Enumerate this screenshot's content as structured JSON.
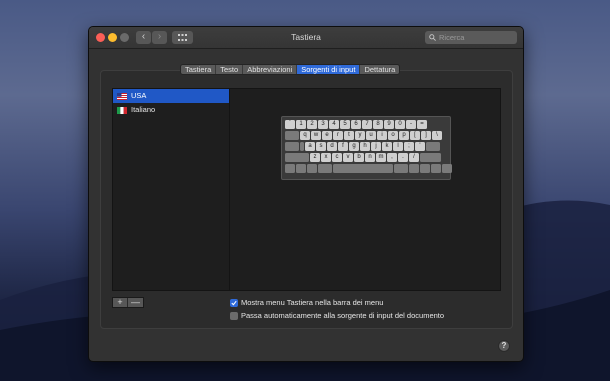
{
  "window": {
    "title": "Tastiera",
    "search_placeholder": "Ricerca",
    "nav": {
      "back": "‹",
      "forward": "›"
    }
  },
  "tabs": [
    {
      "label": "Tastiera",
      "active": false
    },
    {
      "label": "Testo",
      "active": false
    },
    {
      "label": "Abbreviazioni",
      "active": false
    },
    {
      "label": "Sorgenti di input",
      "active": true
    },
    {
      "label": "Dettatura",
      "active": false
    }
  ],
  "input_sources": [
    {
      "label": "USA",
      "flag": "us-flag-icon",
      "selected": true
    },
    {
      "label": "Italiano",
      "flag": "italy-flag-icon",
      "selected": false
    }
  ],
  "keyboard_preview": {
    "row1": [
      "`",
      "1",
      "2",
      "3",
      "4",
      "5",
      "6",
      "7",
      "8",
      "9",
      "0",
      "-",
      "="
    ],
    "row2": [
      "q",
      "w",
      "e",
      "r",
      "t",
      "y",
      "u",
      "i",
      "o",
      "p",
      "[",
      "]",
      "\\"
    ],
    "row3": [
      "a",
      "s",
      "d",
      "f",
      "g",
      "h",
      "j",
      "k",
      "l",
      ";",
      "'"
    ],
    "row4": [
      "z",
      "x",
      "c",
      "v",
      "b",
      "n",
      "m",
      ",",
      ".",
      "/"
    ]
  },
  "list_controls": {
    "add": "+",
    "remove": "—"
  },
  "options": {
    "show_menu": {
      "label": "Mostra menu Tastiera nella barra dei menu",
      "checked": true
    },
    "auto_switch": {
      "label": "Passa automaticamente alla sorgente di input del documento",
      "checked": false
    }
  },
  "help": "?",
  "colors": {
    "accent": "#2f6ad9",
    "window_bg": "#323232",
    "close": "#fc5f57",
    "minimize": "#fdbc2e"
  }
}
